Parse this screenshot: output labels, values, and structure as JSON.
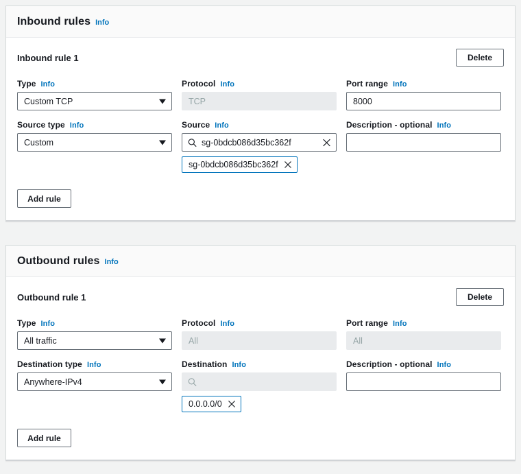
{
  "info_label": "Info",
  "icons": {
    "search": "search-icon",
    "clear": "close-icon",
    "token_remove": "close-icon",
    "dropdown": "chevron-down-icon"
  },
  "colors": {
    "link": "#0073bb",
    "token_border": "#0073bb",
    "page_background": "#f2f3f3",
    "panel_background": "#ffffff",
    "panel_header_background": "#fafafa",
    "border": "#d5dbdb",
    "control_border": "#687078",
    "disabled_background": "#e9ebed",
    "text": "#16191f",
    "placeholder": "#879596"
  },
  "inbound": {
    "section_title": "Inbound rules",
    "rule_title": "Inbound rule 1",
    "delete_label": "Delete",
    "add_rule_label": "Add rule",
    "fields": {
      "type": {
        "label": "Type",
        "value": "Custom TCP"
      },
      "protocol": {
        "label": "Protocol",
        "value": "TCP",
        "disabled": true
      },
      "port_range": {
        "label": "Port range",
        "value": "8000",
        "disabled": false
      },
      "source_type": {
        "label": "Source type",
        "value": "Custom"
      },
      "source": {
        "label": "Source",
        "value": "sg-0bdcb086d35bc362f",
        "placeholder": "",
        "disabled": false,
        "token": "sg-0bdcb086d35bc362f"
      },
      "description": {
        "label": "Description - optional",
        "value": "",
        "placeholder": ""
      }
    }
  },
  "outbound": {
    "section_title": "Outbound rules",
    "rule_title": "Outbound rule 1",
    "delete_label": "Delete",
    "add_rule_label": "Add rule",
    "fields": {
      "type": {
        "label": "Type",
        "value": "All traffic"
      },
      "protocol": {
        "label": "Protocol",
        "value": "All",
        "disabled": true
      },
      "port_range": {
        "label": "Port range",
        "value": "All",
        "disabled": true
      },
      "destination_type": {
        "label": "Destination type",
        "value": "Anywhere-IPv4"
      },
      "destination": {
        "label": "Destination",
        "value": "",
        "placeholder": "",
        "disabled": true,
        "token": "0.0.0.0/0"
      },
      "description": {
        "label": "Description - optional",
        "value": "",
        "placeholder": ""
      }
    }
  }
}
